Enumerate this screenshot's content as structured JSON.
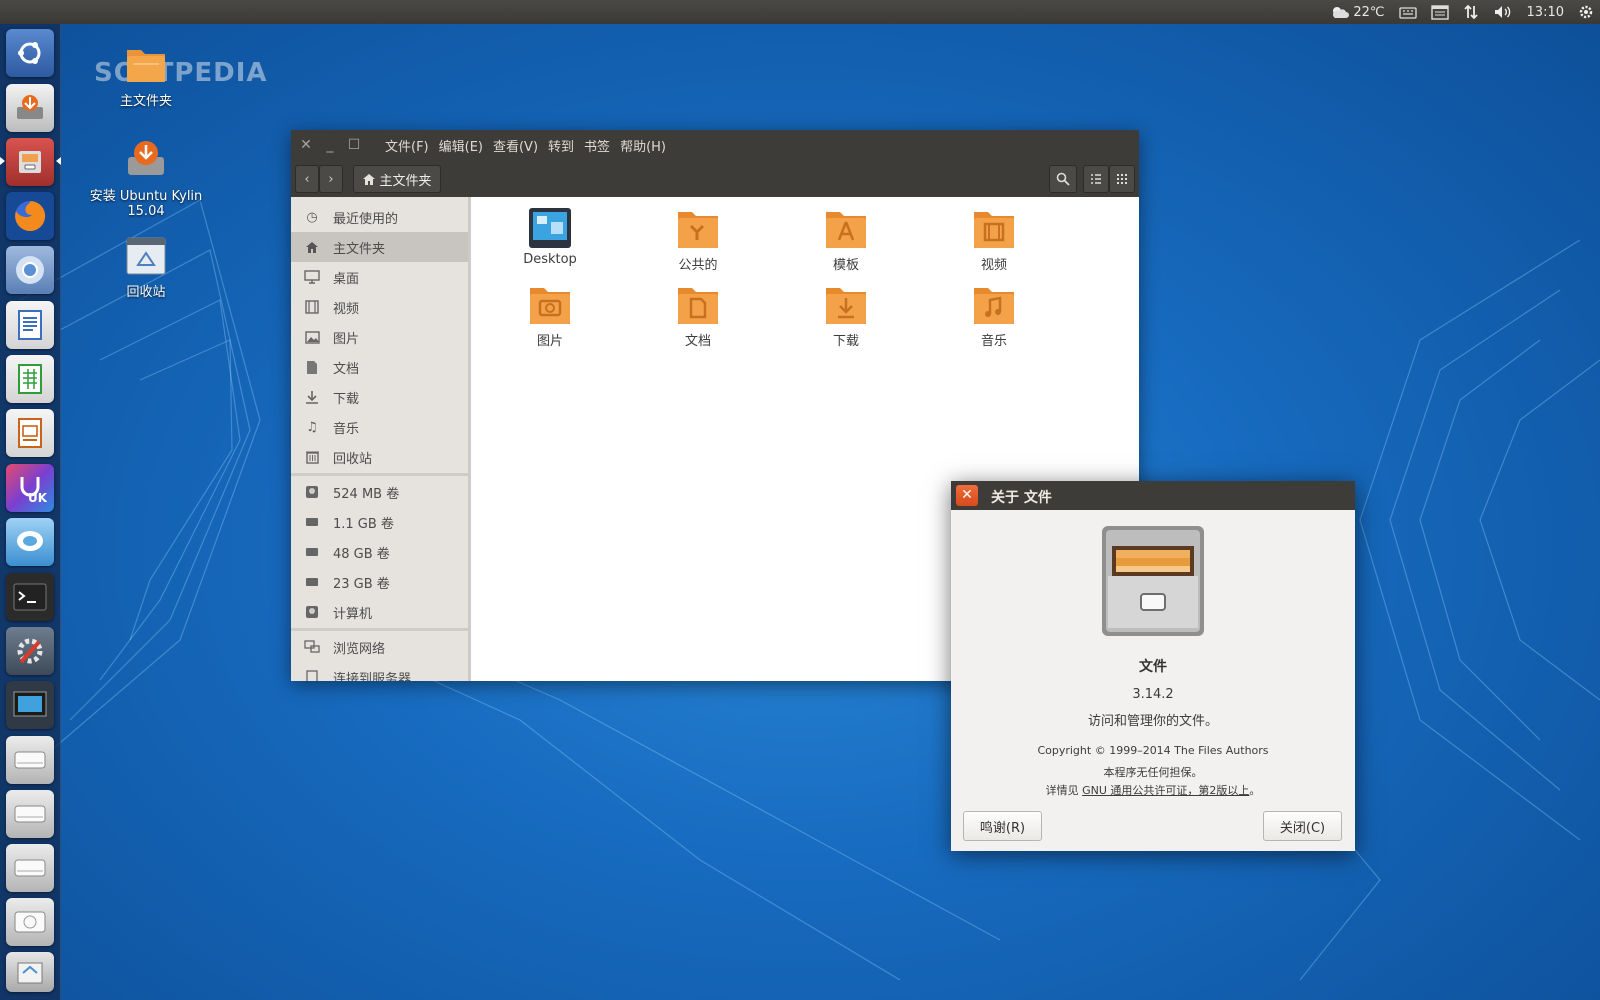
{
  "top_panel": {
    "weather": "22℃",
    "clock": "13:10",
    "icons": [
      "weather-icon",
      "keyboard-icon",
      "calendar-icon",
      "network-icon",
      "volume-icon",
      "gear-icon"
    ]
  },
  "launcher": {
    "items": [
      "dash-icon",
      "installer-icon",
      "files-icon",
      "firefox-icon",
      "chromium-icon",
      "writer-icon",
      "calc-icon",
      "impress-icon",
      "ubuntukylin-icon",
      "chat-icon",
      "terminal-icon",
      "settings-icon",
      "screenshot-icon",
      "drive-icon",
      "drive-icon",
      "drive-icon",
      "drive-icon",
      "trash-icon"
    ]
  },
  "desktop": {
    "watermark": "SOFTPEDIA",
    "icons": [
      {
        "label": "主文件夹"
      },
      {
        "label": "安装 Ubuntu Kylin",
        "label2": "15.04"
      },
      {
        "label": "回收站"
      }
    ]
  },
  "file_manager": {
    "menu": [
      "文件(F)",
      "编辑(E)",
      "查看(V)",
      "转到",
      "书签",
      "帮助(H)"
    ],
    "breadcrumb": "主文件夹",
    "sidebar": [
      {
        "label": "最近使用的",
        "icon": "recent-icon"
      },
      {
        "label": "主文件夹",
        "icon": "home-icon",
        "active": true
      },
      {
        "label": "桌面",
        "icon": "desktop-icon"
      },
      {
        "label": "视频",
        "icon": "video-icon"
      },
      {
        "label": "图片",
        "icon": "picture-icon"
      },
      {
        "label": "文档",
        "icon": "document-icon"
      },
      {
        "label": "下载",
        "icon": "download-icon"
      },
      {
        "label": "音乐",
        "icon": "music-icon"
      },
      {
        "label": "回收站",
        "icon": "trash-icon"
      },
      {
        "label": "524 MB 卷",
        "icon": "drive-icon"
      },
      {
        "label": "1.1 GB 卷",
        "icon": "drive-icon"
      },
      {
        "label": "48 GB 卷",
        "icon": "drive-icon"
      },
      {
        "label": "23 GB 卷",
        "icon": "drive-icon"
      },
      {
        "label": "计算机",
        "icon": "computer-icon"
      },
      {
        "label": "浏览网络",
        "icon": "network-icon"
      },
      {
        "label": "连接到服务器",
        "icon": "server-icon"
      }
    ],
    "folders": [
      {
        "label": "Desktop"
      },
      {
        "label": "公共的"
      },
      {
        "label": "模板"
      },
      {
        "label": "视频"
      },
      {
        "label": "图片"
      },
      {
        "label": "文档"
      },
      {
        "label": "下载"
      },
      {
        "label": "音乐"
      }
    ]
  },
  "about_dialog": {
    "title": "关于 文件",
    "app_name": "文件",
    "version": "3.14.2",
    "description": "访问和管理你的文件。",
    "copyright": "Copyright © 1999–2014 The Files Authors",
    "warranty": "本程序无任何担保。",
    "license_prefix": "详情见 ",
    "license_link": "GNU 通用公共许可证，第2版以上",
    "license_suffix": "。",
    "credits_button": "鸣谢(R)",
    "close_button": "关闭(C)"
  }
}
